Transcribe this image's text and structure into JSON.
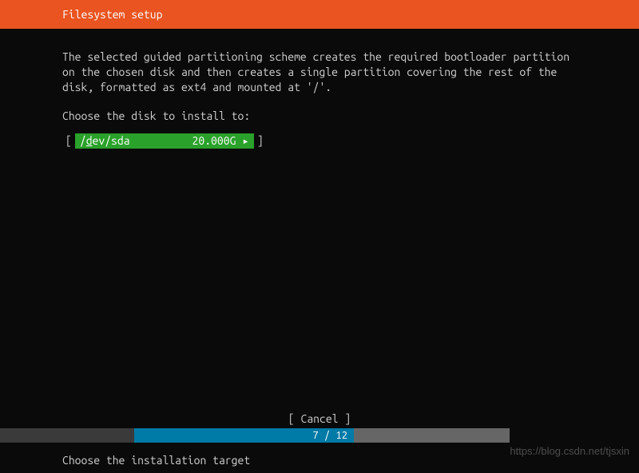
{
  "header": {
    "title": "Filesystem setup"
  },
  "main": {
    "description": "The selected guided partitioning scheme creates the required bootloader partition on the chosen disk and then creates a single partition covering the rest of the disk, formatted as ext4 and mounted at '/'.",
    "prompt": "Choose the disk to install to:",
    "disk": {
      "bracket_open": "[",
      "bracket_close": "]",
      "name_prefix": "/",
      "name_underlined": "d",
      "name_suffix": "ev/sda",
      "size": "20.000G",
      "arrow": "▸"
    }
  },
  "cancel": {
    "label": "[ Cancel     ]"
  },
  "progress": {
    "text": "7 / 12"
  },
  "footer": {
    "text": "Choose the installation target"
  },
  "watermark": {
    "text": "https://blog.csdn.net/tjsxin"
  }
}
